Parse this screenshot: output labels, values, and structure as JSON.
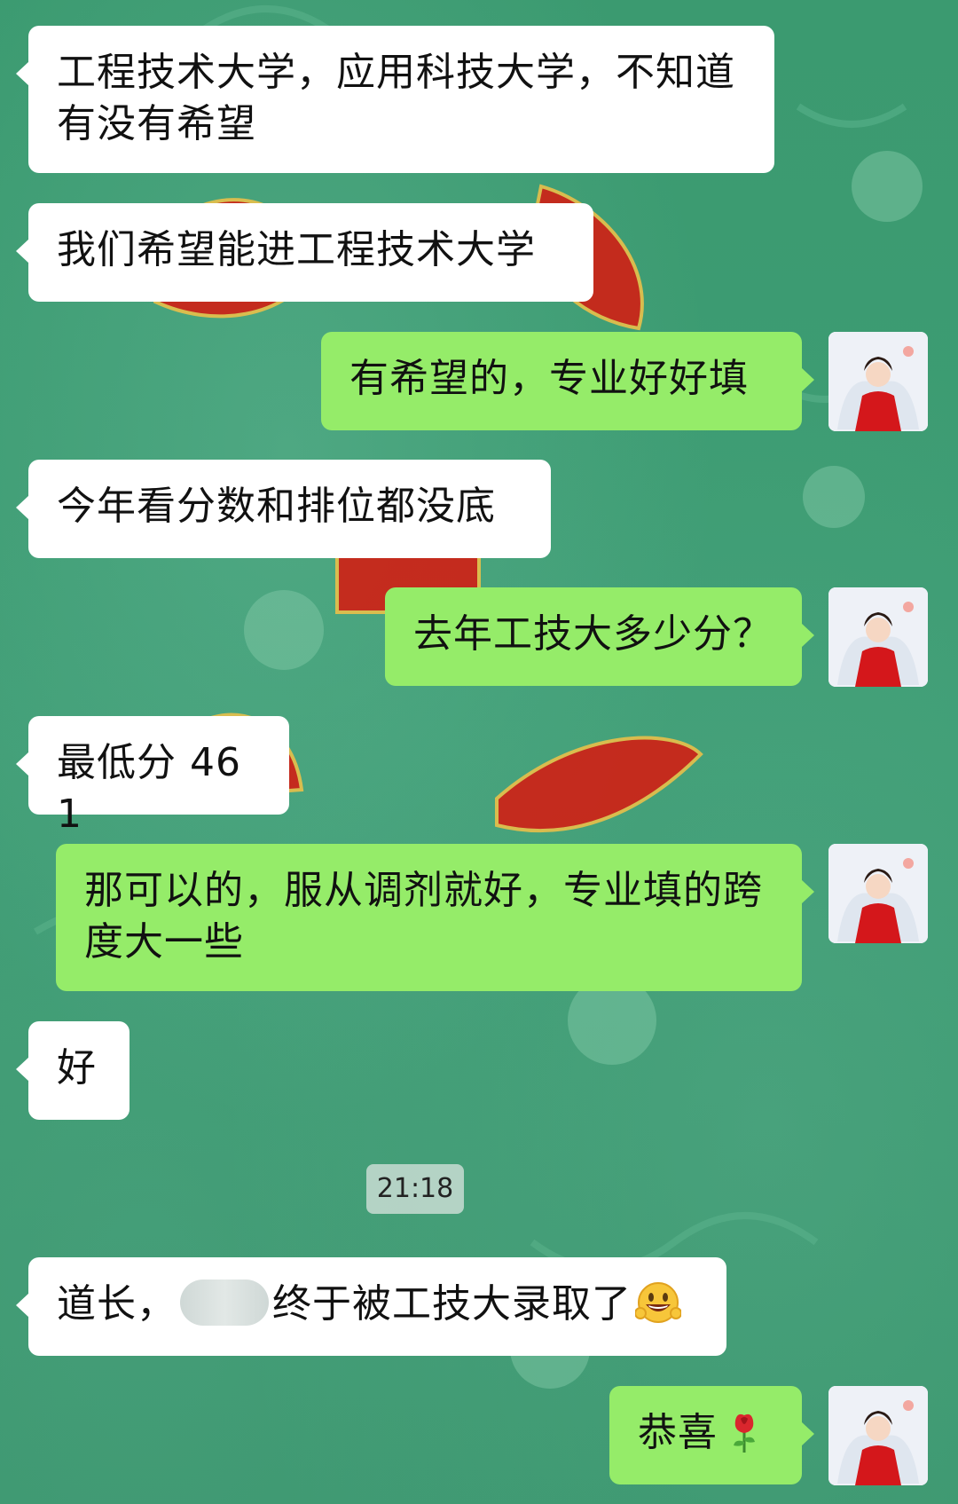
{
  "chat": {
    "messages": [
      {
        "side": "in",
        "text": "工程技术大学，应用科技大学，不知道有没有希望"
      },
      {
        "side": "in",
        "text": "我们希望能进工程技术大学"
      },
      {
        "side": "out",
        "text": "有希望的，专业好好填"
      },
      {
        "side": "in",
        "text": "今年看分数和排位都没底"
      },
      {
        "side": "out",
        "text": "去年工技大多少分？"
      },
      {
        "side": "in",
        "text": "最低分 461"
      },
      {
        "side": "out",
        "text": "那可以的，服从调剂就好，专业填的跨度大一些"
      },
      {
        "side": "in",
        "text": "好"
      },
      {
        "side": "in",
        "text_before": "道长，",
        "text_after": "终于被工技大录取了",
        "emoji": "grinning-face-emoji"
      },
      {
        "side": "out",
        "text": "恭喜",
        "emoji": "rose-emoji"
      }
    ],
    "timestamp": "21:18"
  },
  "colors": {
    "background": "#3f9a72",
    "incoming_bubble": "#ffffff",
    "outgoing_bubble": "#95ec69"
  }
}
